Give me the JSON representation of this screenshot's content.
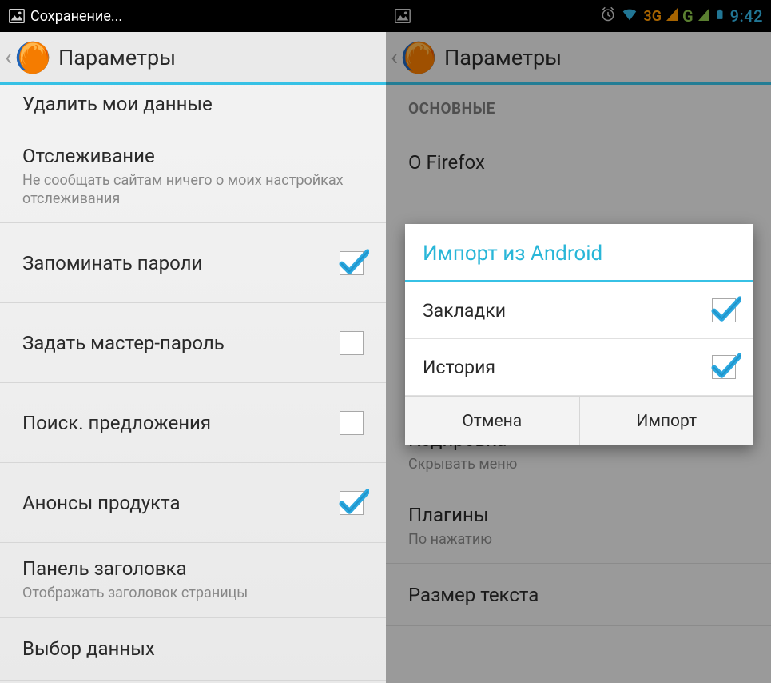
{
  "left": {
    "statusbar": {
      "saving_label": "Сохранение..."
    },
    "actionbar": {
      "title": "Параметры"
    },
    "rows": {
      "delete_data": "Удалить мои данные",
      "tracking_title": "Отслеживание",
      "tracking_sub": "Не сообщать сайтам ничего о моих настройках отслеживания",
      "remember_passwords": "Запоминать пароли",
      "master_password": "Задать мастер-пароль",
      "search_suggestions": "Поиск. предложения",
      "product_announces": "Анонсы продукта",
      "titlebar_title": "Панель заголовка",
      "titlebar_sub": "Отображать заголовок страницы",
      "data_choices": "Выбор данных"
    },
    "checks": {
      "remember_passwords": true,
      "master_password": false,
      "search_suggestions": false,
      "product_announces": true
    }
  },
  "right": {
    "statusbar": {
      "net3g": "3G",
      "netg": "G",
      "clock": "9:42"
    },
    "actionbar": {
      "title": "Параметры"
    },
    "section_header": "ОСНОВНЫЕ",
    "rows": {
      "about_firefox": "О Firefox",
      "encoding_title": "Кодировка",
      "encoding_sub": "Скрывать меню",
      "plugins_title": "Плагины",
      "plugins_sub": "По нажатию",
      "text_size_title": "Размер текста"
    },
    "dialog": {
      "title": "Импорт из Android",
      "bookmarks_label": "Закладки",
      "history_label": "История",
      "bookmarks_checked": true,
      "history_checked": true,
      "cancel": "Отмена",
      "import": "Импорт"
    }
  }
}
